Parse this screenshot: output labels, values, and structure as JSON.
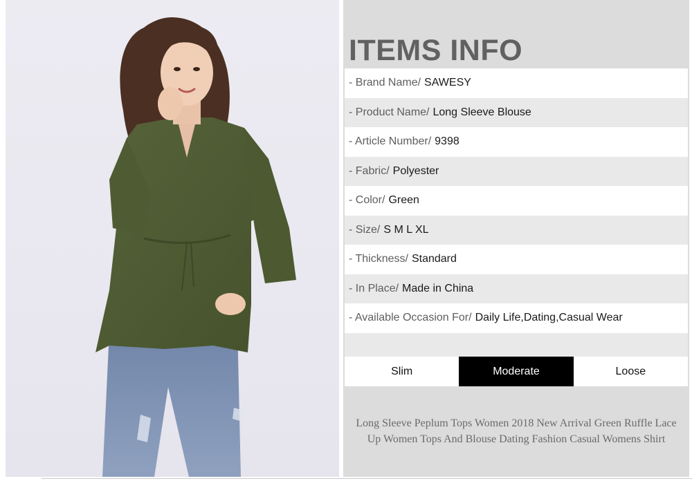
{
  "photo": {
    "alt": "model wearing green long sleeve blouse with jeans"
  },
  "info": {
    "heading": "ITEMS INFO",
    "rows": [
      {
        "label": "- Brand Name/",
        "value": "SAWESY"
      },
      {
        "label": "- Product Name/",
        "value": "Long Sleeve Blouse"
      },
      {
        "label": "- Article Number/",
        "value": "9398"
      },
      {
        "label": "- Fabric/",
        "value": "Polyester"
      },
      {
        "label": "- Color/",
        "value": "Green"
      },
      {
        "label": "- Size/",
        "value": "S M L XL"
      },
      {
        "label": "- Thickness/",
        "value": "Standard"
      },
      {
        "label": "- In Place/",
        "value": "Made in China"
      },
      {
        "label": "- Available Occasion For/",
        "value": "Daily Life,Dating,Casual Wear"
      }
    ]
  },
  "fit": {
    "options": [
      "Slim",
      "Moderate",
      "Loose"
    ],
    "selected": "Moderate"
  },
  "caption": {
    "line1": "Long Sleeve Peplum Tops Women 2018 New Arrival Green Ruffle Lace",
    "line2": "Up Women Tops And Blouse Dating Fashion Casual Womens Shirt"
  },
  "colors": {
    "panel_bg": "#dcdcdc",
    "heading": "#616161",
    "blouse": "#4d5a31",
    "jeans": "#7b8fb0",
    "selected_bg": "#000000"
  }
}
